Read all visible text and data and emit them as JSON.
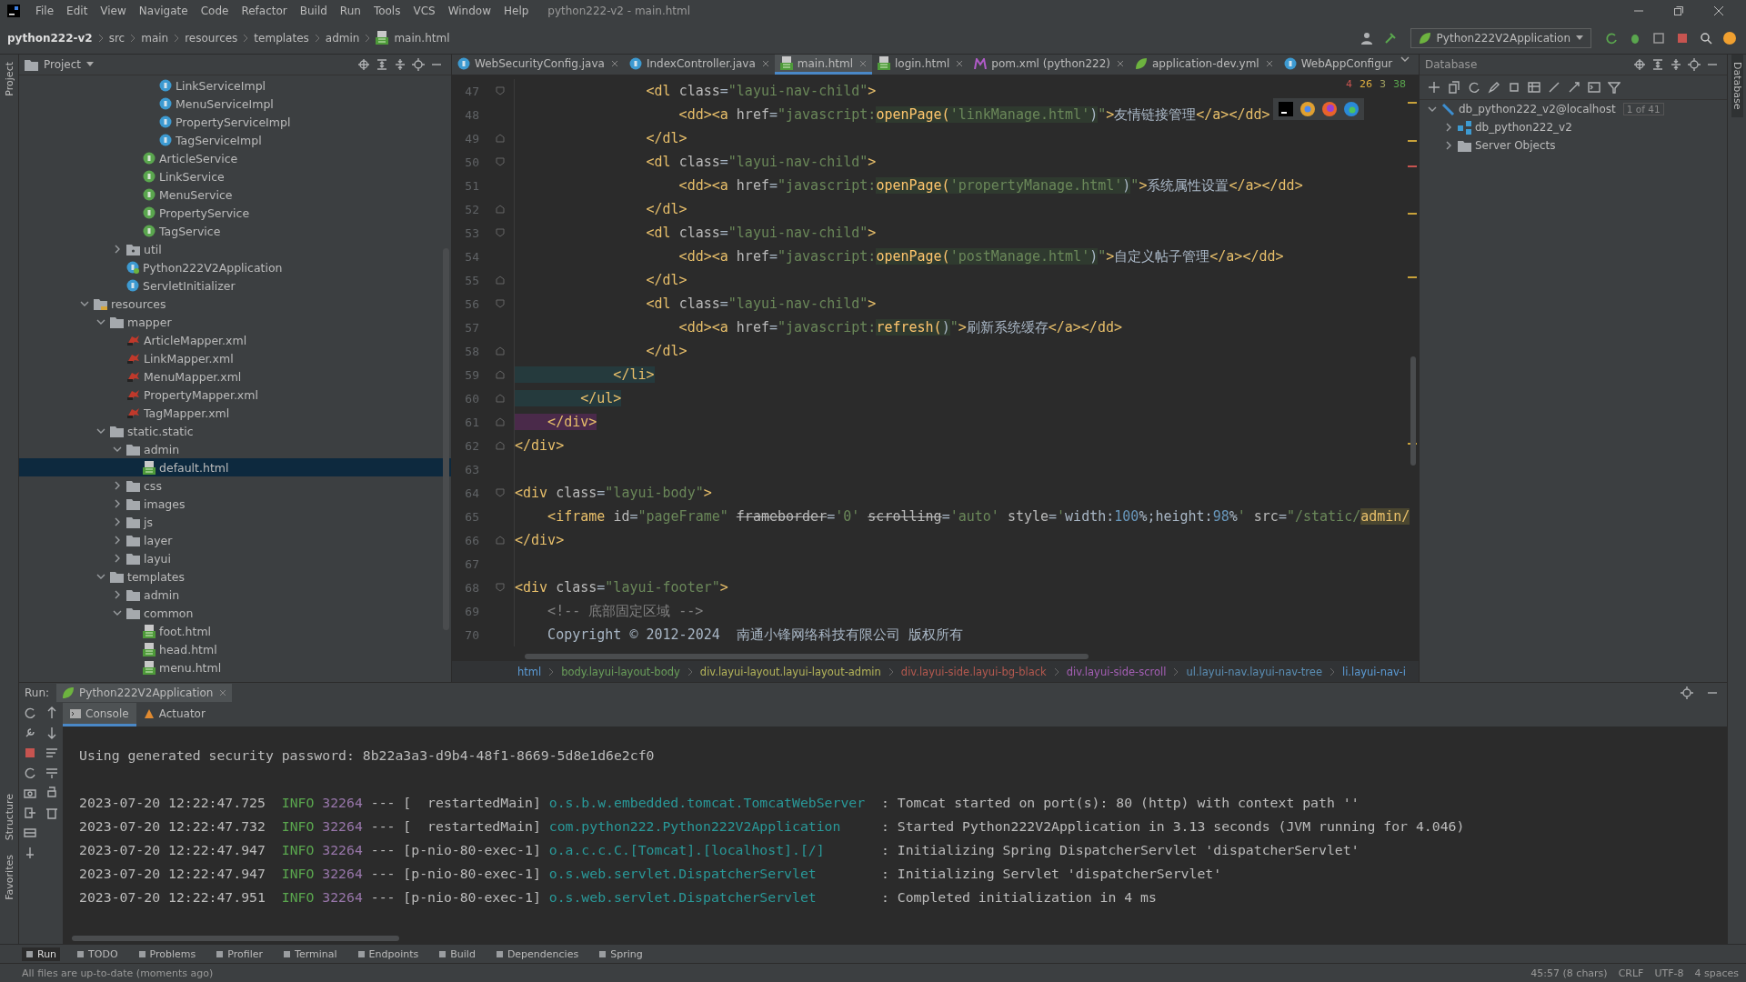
{
  "menu": [
    "File",
    "Edit",
    "View",
    "Navigate",
    "Code",
    "Refactor",
    "Build",
    "Run",
    "Tools",
    "VCS",
    "Window",
    "Help"
  ],
  "window": {
    "title": "python222-v2 - main.html"
  },
  "nav_path": [
    "python222-v2",
    "src",
    "main",
    "resources",
    "templates",
    "admin",
    "main.html"
  ],
  "run_config": {
    "label": "Python222V2Application"
  },
  "project_panel": {
    "title": "Project"
  },
  "tree": [
    {
      "children": [
        {
          "children": [
            {
              "children": [
                {
                  "children": [
                    {
                      "children": [
                        {
                          "label": "LinkServiceImpl",
                          "kind": "class",
                          "selected": false
                        },
                        {
                          "label": "MenuServiceImpl",
                          "kind": "class",
                          "selected": false
                        },
                        {
                          "label": "PropertyServiceImpl",
                          "kind": "class",
                          "selected": false
                        },
                        {
                          "label": "TagServiceImpl",
                          "kind": "class",
                          "selected": false
                        }
                      ]
                    },
                    {
                      "label": "ArticleService",
                      "kind": "interface",
                      "selected": false
                    },
                    {
                      "label": "LinkService",
                      "kind": "interface",
                      "selected": false
                    },
                    {
                      "label": "MenuService",
                      "kind": "interface",
                      "selected": false
                    },
                    {
                      "label": "PropertyService",
                      "kind": "interface",
                      "selected": false
                    },
                    {
                      "label": "TagService",
                      "kind": "interface",
                      "selected": false
                    }
                  ]
                },
                {
                  "label": "util",
                  "kind": "package",
                  "expanded": false,
                  "selected": false
                },
                {
                  "label": "Python222V2Application",
                  "kind": "app",
                  "selected": false
                },
                {
                  "label": "ServletInitializer",
                  "kind": "class",
                  "selected": false
                }
              ]
            }
          ]
        },
        {
          "label": "resources",
          "kind": "resources",
          "expanded": true,
          "selected": false,
          "children": [
            {
              "label": "mapper",
              "kind": "folder",
              "expanded": true,
              "selected": false,
              "children": [
                {
                  "label": "ArticleMapper.xml",
                  "kind": "xml",
                  "selected": false
                },
                {
                  "label": "LinkMapper.xml",
                  "kind": "xml",
                  "selected": false
                },
                {
                  "label": "MenuMapper.xml",
                  "kind": "xml",
                  "selected": false
                },
                {
                  "label": "PropertyMapper.xml",
                  "kind": "xml",
                  "selected": false
                },
                {
                  "label": "TagMapper.xml",
                  "kind": "xml",
                  "selected": false
                }
              ]
            },
            {
              "label": "static.static",
              "kind": "folder",
              "expanded": true,
              "selected": false,
              "children": [
                {
                  "label": "admin",
                  "kind": "folder",
                  "expanded": true,
                  "selected": false,
                  "children": [
                    {
                      "label": "default.html",
                      "kind": "html",
                      "selected": true
                    }
                  ]
                },
                {
                  "label": "css",
                  "kind": "folder",
                  "expanded": false,
                  "selected": false
                },
                {
                  "label": "images",
                  "kind": "folder",
                  "expanded": false,
                  "selected": false
                },
                {
                  "label": "js",
                  "kind": "folder",
                  "expanded": false,
                  "selected": false
                },
                {
                  "label": "layer",
                  "kind": "folder",
                  "expanded": false,
                  "selected": false
                },
                {
                  "label": "layui",
                  "kind": "folder",
                  "expanded": false,
                  "selected": false
                }
              ]
            },
            {
              "label": "templates",
              "kind": "folder",
              "expanded": true,
              "selected": false,
              "children": [
                {
                  "label": "admin",
                  "kind": "folder",
                  "expanded": false,
                  "selected": false
                },
                {
                  "label": "common",
                  "kind": "folder",
                  "expanded": true,
                  "selected": false,
                  "children": [
                    {
                      "label": "foot.html",
                      "kind": "html",
                      "selected": false
                    },
                    {
                      "label": "head.html",
                      "kind": "html",
                      "selected": false
                    },
                    {
                      "label": "menu.html",
                      "kind": "html",
                      "selected": false
                    }
                  ]
                }
              ]
            }
          ]
        }
      ]
    }
  ],
  "editor_tabs": [
    {
      "label": "WebSecurityConfig.java",
      "kind": "class",
      "selected": false,
      "closable": true
    },
    {
      "label": "IndexController.java",
      "kind": "class",
      "selected": false,
      "closable": true
    },
    {
      "label": "main.html",
      "kind": "html",
      "selected": true,
      "closable": true
    },
    {
      "label": "login.html",
      "kind": "html",
      "selected": false,
      "closable": true
    },
    {
      "label": "pom.xml (python222)",
      "kind": "maven",
      "selected": false,
      "closable": true
    },
    {
      "label": "application-dev.yml",
      "kind": "yaml",
      "selected": false,
      "closable": true
    },
    {
      "label": "WebAppConfigur",
      "kind": "class",
      "selected": false,
      "closable": false
    }
  ],
  "inspections": {
    "errors": "4",
    "warnings": "26",
    "weak_warnings": "3",
    "typos": "38"
  },
  "code_lines": [
    {
      "number": "47",
      "kind": "fold-start",
      "tokens": [
        {
          "kind": "tag",
          "t": "                <dl "
        },
        {
          "kind": "attr",
          "t": "class"
        },
        {
          "kind": "text",
          "t": "="
        },
        {
          "kind": "str",
          "t": "\"layui-nav-child\""
        },
        {
          "kind": "tag",
          "t": ">"
        }
      ]
    },
    {
      "number": "48",
      "kind": "plain",
      "tokens": [
        {
          "kind": "tag",
          "t": "                    <dd><a "
        },
        {
          "kind": "attr",
          "t": "href"
        },
        {
          "kind": "text",
          "t": "="
        },
        {
          "kind": "str",
          "t": "\"javascript:"
        },
        {
          "kind": "fn",
          "t": "openPage("
        },
        {
          "kind": "arg",
          "t": "'linkManage.html'"
        },
        {
          "kind": "inj",
          "t": ")"
        },
        {
          "kind": "str",
          "t": "\""
        },
        {
          "kind": "tag",
          "t": ">"
        },
        {
          "kind": "text",
          "t": "友情链接管理"
        },
        {
          "kind": "tag",
          "t": "</a></dd>"
        }
      ]
    },
    {
      "number": "49",
      "kind": "fold-end",
      "tokens": [
        {
          "kind": "tag",
          "t": "                </dl>"
        }
      ]
    },
    {
      "number": "50",
      "kind": "fold-start",
      "tokens": [
        {
          "kind": "tag",
          "t": "                <dl "
        },
        {
          "kind": "attr",
          "t": "class"
        },
        {
          "kind": "text",
          "t": "="
        },
        {
          "kind": "str",
          "t": "\"layui-nav-child\""
        },
        {
          "kind": "tag",
          "t": ">"
        }
      ]
    },
    {
      "number": "51",
      "kind": "plain",
      "tokens": [
        {
          "kind": "tag",
          "t": "                    <dd><a "
        },
        {
          "kind": "attr",
          "t": "href"
        },
        {
          "kind": "text",
          "t": "="
        },
        {
          "kind": "str",
          "t": "\"javascript:"
        },
        {
          "kind": "fn",
          "t": "openPage("
        },
        {
          "kind": "arg",
          "t": "'propertyManage.html'"
        },
        {
          "kind": "inj",
          "t": ")"
        },
        {
          "kind": "str",
          "t": "\""
        },
        {
          "kind": "tag",
          "t": ">"
        },
        {
          "kind": "text",
          "t": "系统属性设置"
        },
        {
          "kind": "tag",
          "t": "</a></dd>"
        }
      ]
    },
    {
      "number": "52",
      "kind": "fold-end",
      "tokens": [
        {
          "kind": "tag",
          "t": "                </dl>"
        }
      ]
    },
    {
      "number": "53",
      "kind": "fold-start",
      "tokens": [
        {
          "kind": "tag",
          "t": "                <dl "
        },
        {
          "kind": "attr",
          "t": "class"
        },
        {
          "kind": "text",
          "t": "="
        },
        {
          "kind": "str",
          "t": "\"layui-nav-child\""
        },
        {
          "kind": "tag",
          "t": ">"
        }
      ]
    },
    {
      "number": "54",
      "kind": "plain",
      "tokens": [
        {
          "kind": "tag",
          "t": "                    <dd><a "
        },
        {
          "kind": "attr",
          "t": "href"
        },
        {
          "kind": "text",
          "t": "="
        },
        {
          "kind": "str",
          "t": "\"javascript:"
        },
        {
          "kind": "fn",
          "t": "openPage("
        },
        {
          "kind": "arg",
          "t": "'postManage.html'"
        },
        {
          "kind": "inj",
          "t": ")"
        },
        {
          "kind": "str",
          "t": "\""
        },
        {
          "kind": "tag",
          "t": ">"
        },
        {
          "kind": "text",
          "t": "自定义帖子管理"
        },
        {
          "kind": "tag",
          "t": "</a></dd>"
        }
      ]
    },
    {
      "number": "55",
      "kind": "fold-end",
      "tokens": [
        {
          "kind": "tag",
          "t": "                </dl>"
        }
      ]
    },
    {
      "number": "56",
      "kind": "fold-start",
      "tokens": [
        {
          "kind": "tag",
          "t": "                <dl "
        },
        {
          "kind": "attr",
          "t": "class"
        },
        {
          "kind": "text",
          "t": "="
        },
        {
          "kind": "str",
          "t": "\"layui-nav-child\""
        },
        {
          "kind": "tag",
          "t": ">"
        }
      ]
    },
    {
      "number": "57",
      "kind": "plain",
      "tokens": [
        {
          "kind": "tag",
          "t": "                    <dd><a "
        },
        {
          "kind": "attr",
          "t": "href"
        },
        {
          "kind": "text",
          "t": "="
        },
        {
          "kind": "str",
          "t": "\"javascript:"
        },
        {
          "kind": "fn",
          "t": "refresh("
        },
        {
          "kind": "inj",
          "t": ")"
        },
        {
          "kind": "str",
          "t": "\""
        },
        {
          "kind": "tag",
          "t": ">"
        },
        {
          "kind": "text",
          "t": "刷新系统缓存"
        },
        {
          "kind": "tag",
          "t": "</a></dd>"
        }
      ]
    },
    {
      "number": "58",
      "kind": "fold-end",
      "tokens": [
        {
          "kind": "tag",
          "t": "                </dl>"
        }
      ]
    },
    {
      "number": "59",
      "kind": "fold-end",
      "tokens": [
        {
          "kind": "match",
          "t": "            </li>"
        }
      ]
    },
    {
      "number": "60",
      "kind": "fold-end",
      "tokens": [
        {
          "kind": "match",
          "t": "        </ul>"
        }
      ]
    },
    {
      "number": "61",
      "kind": "fold-end",
      "tokens": [
        {
          "kind": "match2",
          "t": "    </div>"
        }
      ]
    },
    {
      "number": "62",
      "kind": "fold-end",
      "tokens": [
        {
          "kind": "tag",
          "t": "</div>"
        }
      ]
    },
    {
      "number": "63",
      "kind": "plain"
    },
    {
      "number": "64",
      "kind": "fold-start",
      "tokens": [
        {
          "kind": "tag",
          "t": "<div "
        },
        {
          "kind": "attr",
          "t": "class"
        },
        {
          "kind": "text",
          "t": "="
        },
        {
          "kind": "str",
          "t": "\"layui-body\""
        },
        {
          "kind": "tag",
          "t": ">"
        }
      ]
    },
    {
      "number": "65",
      "kind": "plain",
      "tokens": [
        {
          "kind": "tag",
          "t": "    <iframe "
        },
        {
          "kind": "attr",
          "t": "id"
        },
        {
          "kind": "text",
          "t": "="
        },
        {
          "kind": "str",
          "t": "\"pageFrame\" "
        },
        {
          "kind": "strike",
          "t": "frameborder"
        },
        {
          "kind": "text",
          "t": "="
        },
        {
          "kind": "str",
          "t": "'0' "
        },
        {
          "kind": "strike",
          "t": "scrolling"
        },
        {
          "kind": "text",
          "t": "="
        },
        {
          "kind": "str",
          "t": "'auto' "
        },
        {
          "kind": "attr",
          "t": "style"
        },
        {
          "kind": "text",
          "t": "="
        },
        {
          "kind": "str",
          "t": "'"
        },
        {
          "kind": "text",
          "t": "width:"
        },
        {
          "kind": "num",
          "t": "100"
        },
        {
          "kind": "text",
          "t": "%;height:"
        },
        {
          "kind": "num",
          "t": "98"
        },
        {
          "kind": "text",
          "t": "%"
        },
        {
          "kind": "str",
          "t": "' "
        },
        {
          "kind": "attr",
          "t": "src"
        },
        {
          "kind": "text",
          "t": "="
        },
        {
          "kind": "str",
          "t": "\"/static/"
        },
        {
          "kind": "hl",
          "t": "admin/"
        }
      ]
    },
    {
      "number": "66",
      "kind": "fold-end",
      "tokens": [
        {
          "kind": "tag",
          "t": "</div>"
        }
      ]
    },
    {
      "number": "67",
      "kind": "plain"
    },
    {
      "number": "68",
      "kind": "fold-start",
      "tokens": [
        {
          "kind": "tag",
          "t": "<div "
        },
        {
          "kind": "attr",
          "t": "class"
        },
        {
          "kind": "text",
          "t": "="
        },
        {
          "kind": "str",
          "t": "\"layui-footer\""
        },
        {
          "kind": "tag",
          "t": ">"
        }
      ]
    },
    {
      "number": "69",
      "kind": "plain",
      "tokens": [
        {
          "kind": "comment",
          "t": "    <!-- 底部固定区域 -->"
        }
      ]
    },
    {
      "number": "70",
      "kind": "plain",
      "tokens": [
        {
          "kind": "text",
          "t": "    Copyright © 2012-2024  南通小锋网络科技有限公司 版权所有"
        }
      ]
    }
  ],
  "breadcrumbs": [
    {
      "label": "html",
      "color": "#5b9bd5"
    },
    {
      "label": "body.layui-layout-body",
      "color": "#6a9f5b"
    },
    {
      "label": "div.layui-layout.layui-layout-admin",
      "color": "#b5b55a"
    },
    {
      "label": "div.layui-side.layui-bg-black",
      "color": "#b5594f"
    },
    {
      "label": "div.layui-side-scroll",
      "color": "#a55fb5"
    },
    {
      "label": "ul.layui-nav.layui-nav-tree",
      "color": "#5b8fb5"
    },
    {
      "label": "li.layui-nav-i",
      "color": "#5b9bd5"
    }
  ],
  "database": {
    "title": "Database",
    "tree": [
      {
        "label": "db_python222_v2@localhost",
        "badge": "1 of 41",
        "kind": "datasource",
        "expanded": true,
        "children": [
          {
            "label": "db_python222_v2",
            "kind": "schema",
            "expanded": false
          },
          {
            "label": "Server Objects",
            "kind": "folder",
            "expanded": false
          }
        ]
      }
    ]
  },
  "run_panel": {
    "label": "Run:",
    "tab": "Python222V2Application",
    "tabs": [
      {
        "label": "Console",
        "selected": true
      },
      {
        "label": "Actuator",
        "selected": false
      }
    ]
  },
  "console_lines": [
    [
      {
        "kind": "plain",
        "t": "Using generated security password: 8b22a3a3-d9b4-48f1-8669-5d8e1d6e2cf0"
      }
    ],
    [
      {
        "kind": "plain",
        "t": "2023-07-20 12:22:47.725  "
      },
      {
        "kind": "level",
        "t": "INFO"
      },
      {
        "kind": "pid",
        "t": " 32264"
      },
      {
        "kind": "plain",
        "t": " --- [  restartedMain] "
      },
      {
        "kind": "logger",
        "t": "o.s.b.w.embedded.tomcat.TomcatWebServer"
      },
      {
        "kind": "plain",
        "t": "  : Tomcat started on port(s): 80 (http) with context path ''"
      }
    ],
    [
      {
        "kind": "plain",
        "t": "2023-07-20 12:22:47.732  "
      },
      {
        "kind": "level",
        "t": "INFO"
      },
      {
        "kind": "pid",
        "t": " 32264"
      },
      {
        "kind": "plain",
        "t": " --- [  restartedMain] "
      },
      {
        "kind": "logger",
        "t": "com.python222.Python222V2Application"
      },
      {
        "kind": "plain",
        "t": "     : Started Python222V2Application in 3.13 seconds (JVM running for 4.046)"
      }
    ],
    [
      {
        "kind": "plain",
        "t": "2023-07-20 12:22:47.947  "
      },
      {
        "kind": "level",
        "t": "INFO"
      },
      {
        "kind": "pid",
        "t": " 32264"
      },
      {
        "kind": "plain",
        "t": " --- [p-nio-80-exec-1] "
      },
      {
        "kind": "logger",
        "t": "o.a.c.c.C.[Tomcat].[localhost].[/]"
      },
      {
        "kind": "plain",
        "t": "       : Initializing Spring DispatcherServlet 'dispatcherServlet'"
      }
    ],
    [
      {
        "kind": "plain",
        "t": "2023-07-20 12:22:47.947  "
      },
      {
        "kind": "level",
        "t": "INFO"
      },
      {
        "kind": "pid",
        "t": " 32264"
      },
      {
        "kind": "plain",
        "t": " --- [p-nio-80-exec-1] "
      },
      {
        "kind": "logger",
        "t": "o.s.web.servlet.DispatcherServlet"
      },
      {
        "kind": "plain",
        "t": "        : Initializing Servlet 'dispatcherServlet'"
      }
    ],
    [
      {
        "kind": "plain",
        "t": "2023-07-20 12:22:47.951  "
      },
      {
        "kind": "level",
        "t": "INFO"
      },
      {
        "kind": "pid",
        "t": " 32264"
      },
      {
        "kind": "plain",
        "t": " --- [p-nio-80-exec-1] "
      },
      {
        "kind": "logger",
        "t": "o.s.web.servlet.DispatcherServlet"
      },
      {
        "kind": "plain",
        "t": "        : Completed initialization in 4 ms"
      }
    ]
  ],
  "tool_windows": [
    {
      "label": "Run",
      "selected": true
    },
    {
      "label": "TODO",
      "selected": false
    },
    {
      "label": "Problems",
      "selected": false
    },
    {
      "label": "Profiler",
      "selected": false
    },
    {
      "label": "Terminal",
      "selected": false
    },
    {
      "label": "Endpoints",
      "selected": false
    },
    {
      "label": "Build",
      "selected": false
    },
    {
      "label": "Dependencies",
      "selected": false
    },
    {
      "label": "Spring",
      "selected": false
    }
  ],
  "side_tabs_left": [
    "Project",
    "Structure",
    "Favorites"
  ],
  "side_tabs_right": [
    "Database"
  ],
  "status_bar": {
    "message": "All files are up-to-date (moments ago)",
    "position": "45:57 (8 chars)",
    "line_separator": "CRLF",
    "encoding": "UTF-8",
    "indent": "4 spaces"
  }
}
